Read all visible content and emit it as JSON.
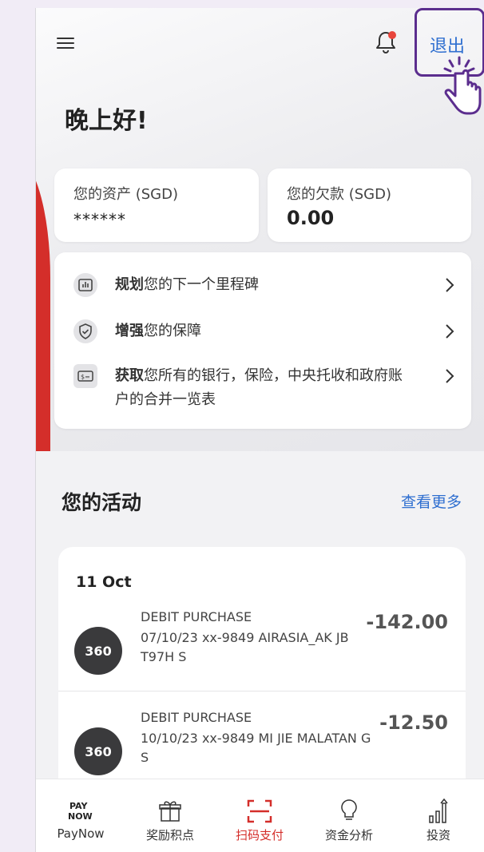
{
  "header": {
    "logout_label": "退出"
  },
  "greeting": "晚上好!",
  "assets": {
    "label": "您的资产 (SGD)",
    "value": "******"
  },
  "debts": {
    "label": "您的欠款 (SGD)",
    "value": "0.00"
  },
  "quick_links": [
    {
      "bold": "规划",
      "rest": "您的下一个里程碑",
      "icon": "chart-icon"
    },
    {
      "bold": "增强",
      "rest": "您的保障",
      "icon": "shield-icon"
    },
    {
      "bold": "获取",
      "rest": "您所有的银行，保险，中央托收和政府账户的合并一览表",
      "icon": "money-icon"
    }
  ],
  "activity": {
    "title": "您的活动",
    "see_more": "查看更多",
    "date": "11 Oct",
    "transactions": [
      {
        "badge": "360",
        "type": "DEBIT PURCHASE",
        "desc": "07/10/23 xx-9849 AIRASIA_AK JB T97H S",
        "amount": "-142.00"
      },
      {
        "badge": "360",
        "type": "DEBIT PURCHASE",
        "desc": "10/10/23 xx-9849 MI JIE MALATAN G S",
        "amount": "-12.50"
      }
    ]
  },
  "tabs": [
    {
      "label": "PayNow",
      "icon": "paynow-icon"
    },
    {
      "label": "奖励积点",
      "icon": "gift-icon"
    },
    {
      "label": "扫码支付",
      "icon": "scan-icon",
      "active": true
    },
    {
      "label": "资金分析",
      "icon": "lightbulb-icon"
    },
    {
      "label": "投资",
      "icon": "invest-chart-icon"
    }
  ],
  "colors": {
    "accent_red": "#d42e2a",
    "link_blue": "#2f6fd0",
    "highlight_purple": "#5b2d8e"
  }
}
